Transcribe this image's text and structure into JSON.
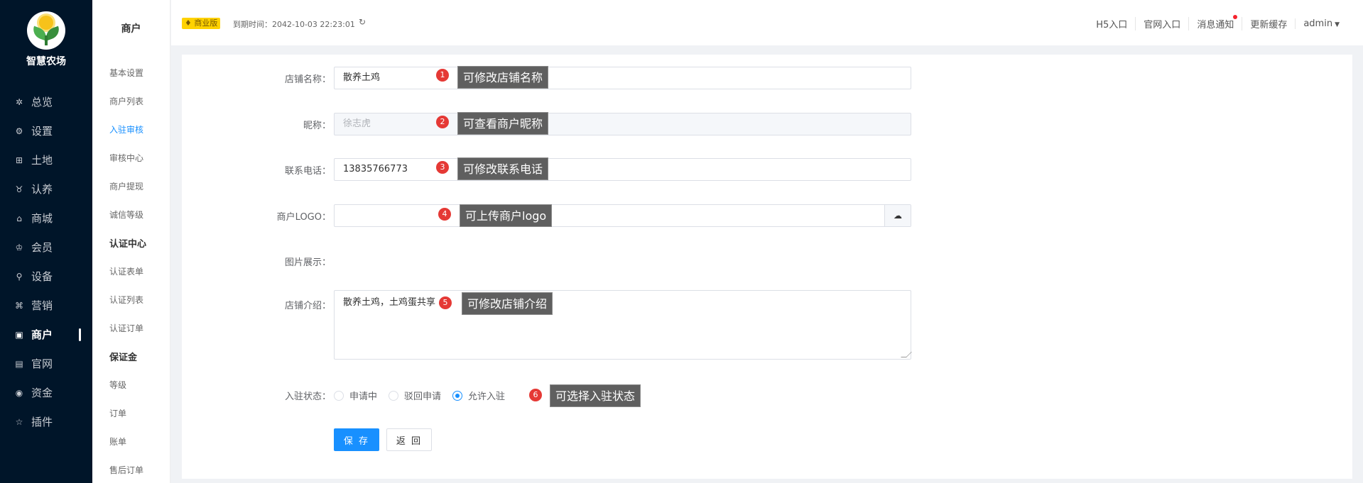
{
  "sidebar": {
    "app_name": "智慧农场",
    "items": [
      {
        "label": "总览",
        "icon": "dashboard-icon",
        "glyph": "✲"
      },
      {
        "label": "设置",
        "icon": "gear-icon",
        "glyph": "⚙"
      },
      {
        "label": "土地",
        "icon": "grid-icon",
        "glyph": "⊞"
      },
      {
        "label": "认养",
        "icon": "adopt-icon",
        "glyph": "♉"
      },
      {
        "label": "商城",
        "icon": "shop-icon",
        "glyph": "⌂"
      },
      {
        "label": "会员",
        "icon": "member-icon",
        "glyph": "♔"
      },
      {
        "label": "设备",
        "icon": "device-icon",
        "glyph": "⚲"
      },
      {
        "label": "营销",
        "icon": "marketing-icon",
        "glyph": "⌘"
      },
      {
        "label": "商户",
        "icon": "merchant-icon",
        "glyph": "▣",
        "active": true
      },
      {
        "label": "官网",
        "icon": "website-icon",
        "glyph": "▤"
      },
      {
        "label": "资金",
        "icon": "fund-icon",
        "glyph": "◉"
      },
      {
        "label": "插件",
        "icon": "plugin-icon",
        "glyph": "☆"
      }
    ]
  },
  "subbar": {
    "title": "商户",
    "items": [
      {
        "label": "基本设置"
      },
      {
        "label": "商户列表"
      },
      {
        "label": "入驻审核",
        "active": true
      },
      {
        "label": "审核中心"
      },
      {
        "label": "商户提现"
      },
      {
        "label": "诚信等级"
      },
      {
        "label": "认证中心",
        "group": true
      },
      {
        "label": "认证表单"
      },
      {
        "label": "认证列表"
      },
      {
        "label": "认证订单"
      },
      {
        "label": "保证金",
        "group": true
      },
      {
        "label": "等级"
      },
      {
        "label": "订单"
      },
      {
        "label": "账单"
      },
      {
        "label": "售后订单"
      }
    ]
  },
  "header": {
    "badge": "商业版",
    "expire": "到期时间：2042-10-03 22:23:01",
    "links": [
      "H5入口",
      "官网入口",
      "消息通知",
      "更新缓存"
    ],
    "user": "admin"
  },
  "form": {
    "store_name_label": "店铺名称：",
    "store_name_value": "散养土鸡",
    "nickname_label": "昵称：",
    "nickname_value": "徐志虎",
    "phone_label": "联系电话：",
    "phone_value": "13835766773",
    "logo_label": "商户LOGO：",
    "image_label": "图片展示：",
    "intro_label": "店铺介绍：",
    "intro_value": "散养土鸡，土鸡蛋共享",
    "status_label": "入驻状态：",
    "status_options": [
      "申请中",
      "驳回申请",
      "允许入驻"
    ],
    "status_selected": "允许入驻",
    "save_label": "保 存",
    "back_label": "返 回"
  },
  "callouts": [
    {
      "num": "1",
      "text": "可修改店铺名称"
    },
    {
      "num": "2",
      "text": "可查看商户昵称"
    },
    {
      "num": "3",
      "text": "可修改联系电话"
    },
    {
      "num": "4",
      "text": "可上传商户logo"
    },
    {
      "num": "5",
      "text": "可修改店铺介绍"
    },
    {
      "num": "6",
      "text": "可选择入驻状态"
    }
  ],
  "colors": {
    "sidebar_bg": "#001529",
    "primary": "#1890ff",
    "badge": "#ffd200",
    "marker": "#e53935",
    "tooltip": "#5f5f5f"
  }
}
